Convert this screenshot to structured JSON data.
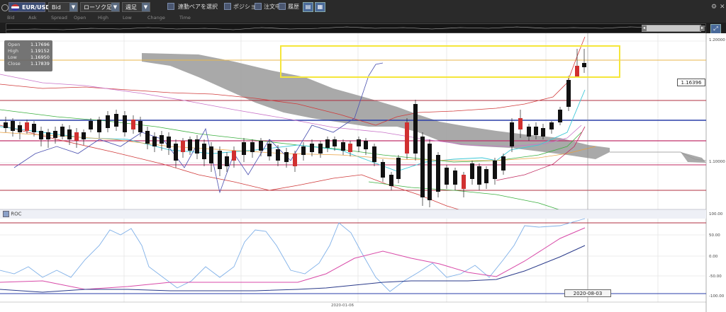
{
  "toolbar": {
    "pair": "EUR/USD",
    "price_type": "Bid",
    "chart_type": "ローソク足",
    "timeframe": "週足",
    "link_pair_label": "連動ペアを選択",
    "position_label": "ポジション",
    "orders_label": "注文中",
    "history_label": "履歴"
  },
  "legend": [
    "Bid",
    "Ask",
    "Spread",
    "Open",
    "High",
    "Low",
    "Change",
    "Time"
  ],
  "ohlc": {
    "open_label": "Open",
    "open": "1.17696",
    "high_label": "High",
    "high": "1.19152",
    "low_label": "Low",
    "low": "1.16950",
    "close_label": "Close",
    "close": "1.17839"
  },
  "price_tag": "1.16396",
  "date_tag": "2020-08-03",
  "x_label": "2020-01-06",
  "price_axis": {
    "top": "1.20000",
    "mid": "1.10000"
  },
  "indicator": {
    "name": "ROC",
    "axis": [
      "100.00",
      "50.00",
      "0.00",
      "-50.00",
      "-100.00"
    ]
  },
  "colors": {
    "bull": "#d03030",
    "bear": "#111111",
    "highlight": "#f5e63a",
    "cloud": "#999999"
  }
}
